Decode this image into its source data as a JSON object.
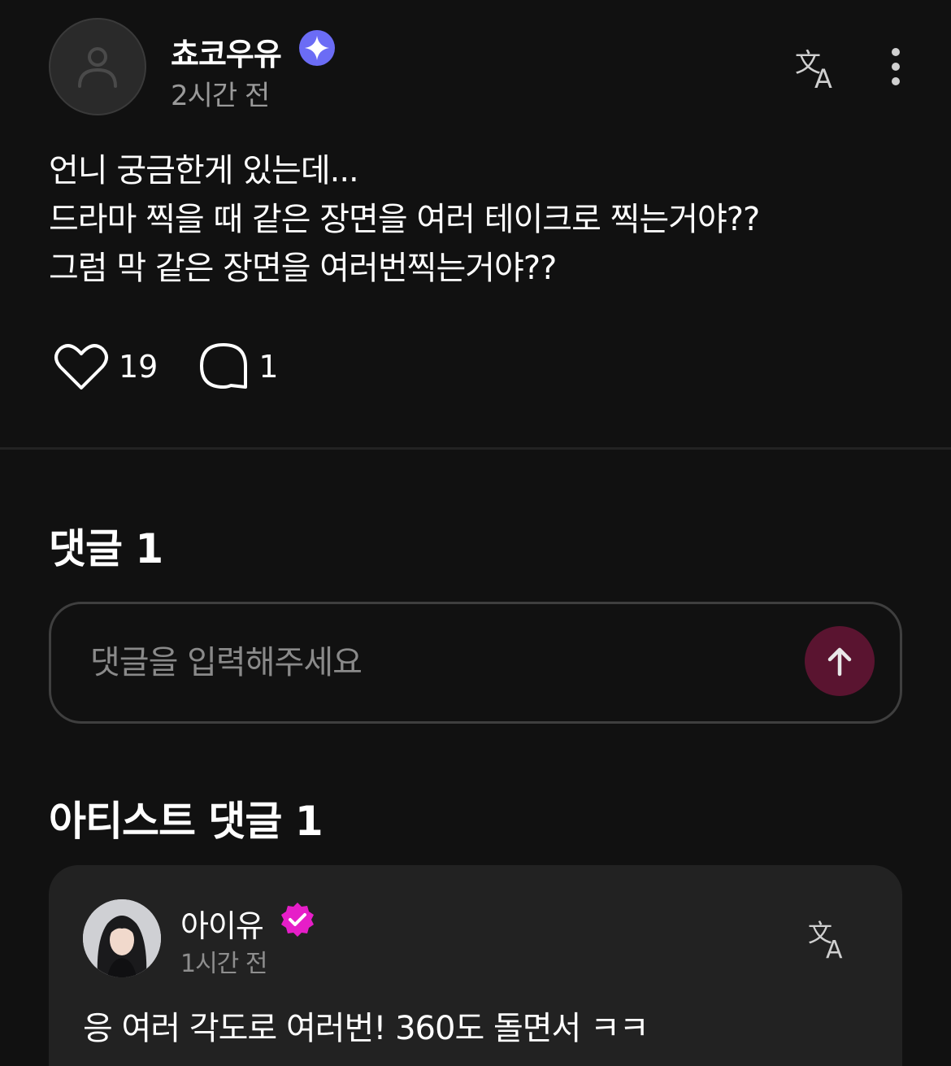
{
  "post": {
    "author": "쵸코우유",
    "time": "2시간 전",
    "body_lines": [
      "언니 궁금한게 있는데...",
      "드라마 찍을 때 같은 장면을 여러 테이크로 찍는거야??",
      "그럼 막 같은 장면을 여러번찍는거야??"
    ],
    "likes": "19",
    "comments": "1"
  },
  "comments_section": {
    "title": "댓글 1",
    "input_placeholder": "댓글을 입력해주세요"
  },
  "artist_section": {
    "title": "아티스트 댓글 1",
    "comment": {
      "author": "아이유",
      "time": "1시간 전",
      "text": "응 여러 각도로 여러번! 360도 돌면서 ㅋㅋ"
    }
  },
  "colors": {
    "background": "#111111",
    "card": "#222222",
    "badge_blue": "#6b6cf5",
    "badge_pink": "#e61ec8",
    "send_button": "#5a1430",
    "muted_text": "#9a9a9a"
  },
  "icons": {
    "avatar_placeholder": "person-outline-icon",
    "author_badge": "sparkle-badge-icon",
    "translate": "translate-icon",
    "more": "vertical-dots-icon",
    "like": "heart-outline-icon",
    "comment": "speech-bubble-icon",
    "send": "arrow-up-icon",
    "artist_badge": "verified-check-badge-icon"
  }
}
